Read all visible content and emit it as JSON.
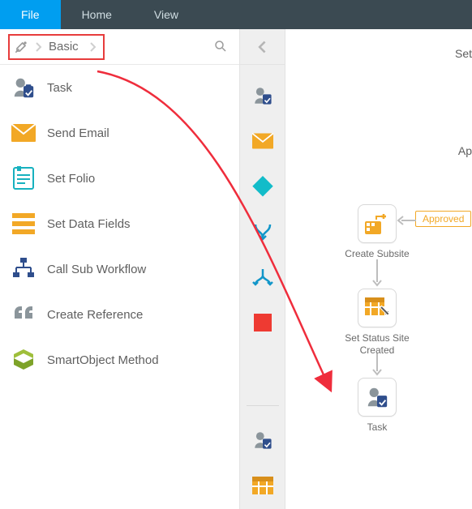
{
  "topbar": {
    "tabs": [
      {
        "label": "File",
        "active": true
      },
      {
        "label": "Home",
        "active": false
      },
      {
        "label": "View",
        "active": false
      }
    ]
  },
  "breadcrumb": {
    "category": "Basic"
  },
  "tools": {
    "items": [
      {
        "label": "Task"
      },
      {
        "label": "Send Email"
      },
      {
        "label": "Set Folio"
      },
      {
        "label": "Set Data Fields"
      },
      {
        "label": "Call Sub Workflow"
      },
      {
        "label": "Create Reference"
      },
      {
        "label": "SmartObject Method"
      }
    ]
  },
  "canvas": {
    "cut_labels": {
      "top": "Set",
      "mid": "Ap"
    },
    "badge": "Approved",
    "nodes": {
      "create_subsite": "Create Subsite",
      "set_status": "Set Status Site Created",
      "task": "Task"
    }
  }
}
